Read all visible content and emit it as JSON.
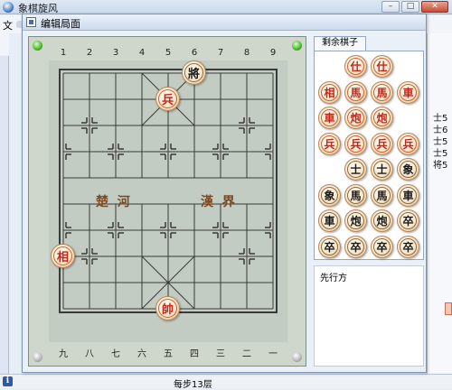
{
  "main_window": {
    "title": "象棋旋风",
    "menu_first": "文"
  },
  "dialog": {
    "title": "编辑局面"
  },
  "board": {
    "files_top": [
      "1",
      "2",
      "3",
      "4",
      "5",
      "6",
      "7",
      "8",
      "9"
    ],
    "files_bottom": [
      "九",
      "八",
      "七",
      "六",
      "五",
      "四",
      "三",
      "二",
      "一"
    ],
    "river_left": "楚  河",
    "river_right": "漢  界",
    "pieces": [
      {
        "char": "將",
        "side": "black",
        "file": 5,
        "rank": 0
      },
      {
        "char": "兵",
        "side": "red",
        "file": 4,
        "rank": 1
      },
      {
        "char": "相",
        "side": "red",
        "file": 0,
        "rank": 7
      },
      {
        "char": "帥",
        "side": "red",
        "file": 4,
        "rank": 9
      }
    ]
  },
  "tray": {
    "tab_label": "剩余棋子",
    "rows": [
      [
        {
          "char": "仕",
          "side": "red"
        },
        {
          "char": "仕",
          "side": "red"
        }
      ],
      [
        {
          "char": "相",
          "side": "red"
        },
        {
          "char": "馬",
          "side": "red"
        },
        {
          "char": "馬",
          "side": "red"
        },
        {
          "char": "車",
          "side": "red"
        }
      ],
      [
        {
          "char": "車",
          "side": "red"
        },
        {
          "char": "炮",
          "side": "red"
        },
        {
          "char": "炮",
          "side": "red"
        }
      ],
      [
        {
          "char": "兵",
          "side": "red"
        },
        {
          "char": "兵",
          "side": "red"
        },
        {
          "char": "兵",
          "side": "red"
        },
        {
          "char": "兵",
          "side": "red"
        }
      ],
      [
        {
          "char": "士",
          "side": "black"
        },
        {
          "char": "士",
          "side": "black"
        },
        {
          "char": "象",
          "side": "black"
        }
      ],
      [
        {
          "char": "象",
          "side": "black"
        },
        {
          "char": "馬",
          "side": "black"
        },
        {
          "char": "馬",
          "side": "black"
        },
        {
          "char": "車",
          "side": "black"
        }
      ],
      [
        {
          "char": "車",
          "side": "black"
        },
        {
          "char": "炮",
          "side": "black"
        },
        {
          "char": "炮",
          "side": "black"
        },
        {
          "char": "卒",
          "side": "black"
        }
      ],
      [
        {
          "char": "卒",
          "side": "black"
        },
        {
          "char": "卒",
          "side": "black"
        },
        {
          "char": "卒",
          "side": "black"
        },
        {
          "char": "卒",
          "side": "black"
        }
      ]
    ]
  },
  "turn_panel": {
    "label": "先行方"
  },
  "right_strip": {
    "labels": [
      "士5",
      "士6",
      "士5",
      "士5",
      "将5"
    ]
  },
  "statusbar": {
    "info_icon": "i",
    "text": "每步13层"
  }
}
